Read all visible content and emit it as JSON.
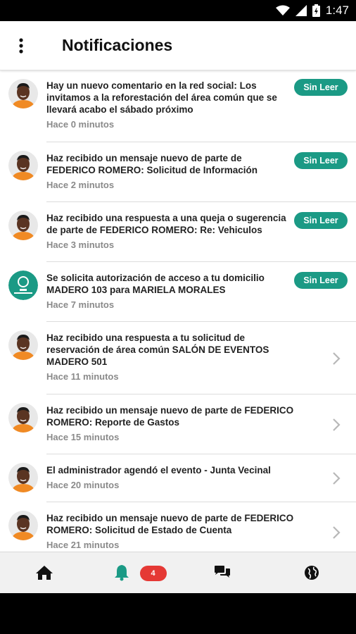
{
  "status_bar": {
    "time": "1:47"
  },
  "header": {
    "title": "Notificaciones"
  },
  "notifications": [
    {
      "message": "Hay un nuevo comentario en la red social:  Los invitamos a la reforestación del área común que se llevará acabo el sábado próximo",
      "time": "Hace 0 minutos",
      "badge": "Sin Leer",
      "avatar": "person-avatar"
    },
    {
      "message": "Haz recibido un mensaje nuevo de parte de FEDERICO ROMERO: Solicitud de Información",
      "time": "Hace 2 minutos",
      "badge": "Sin Leer",
      "avatar": "person-avatar"
    },
    {
      "message": "Haz recibido una respuesta a una queja o sugerencia de parte de FEDERICO ROMERO: Re: Vehiculos",
      "time": "Hace 3 minutos",
      "badge": "Sin Leer",
      "avatar": "person-avatar"
    },
    {
      "message": "Se solicita autorización de acceso a tu domicilio MADERO 103  para MARIELA MORALES",
      "time": "Hace 7 minutos",
      "badge": "Sin Leer",
      "avatar": "seguridad-logo"
    },
    {
      "message": "Haz recibido una respuesta a tu solicitud de reservación de área común SALÓN DE EVENTOS MADERO 501",
      "time": "Hace 11 minutos",
      "badge": "",
      "avatar": "person-avatar"
    },
    {
      "message": "Haz recibido un mensaje nuevo de parte de  FEDERICO ROMERO: Reporte de Gastos",
      "time": "Hace 15 minutos",
      "badge": "",
      "avatar": "person-avatar"
    },
    {
      "message": "El administrador agendó el evento - Junta Vecinal",
      "time": "Hace 20 minutos",
      "badge": "",
      "avatar": "person-avatar"
    },
    {
      "message": "Haz recibido un mensaje nuevo de parte de  FEDERICO ROMERO: Solicitud de Estado de Cuenta",
      "time": "Hace 21 minutos",
      "badge": "",
      "avatar": "person-avatar"
    }
  ],
  "bottom_nav": {
    "items": [
      "home-icon",
      "bell-icon",
      "chat-icon",
      "globe-icon"
    ],
    "notification_count": "4"
  },
  "colors": {
    "accent": "#1b9a85",
    "count_badge": "#e53935",
    "avatar_shirt": "#f08a24"
  }
}
